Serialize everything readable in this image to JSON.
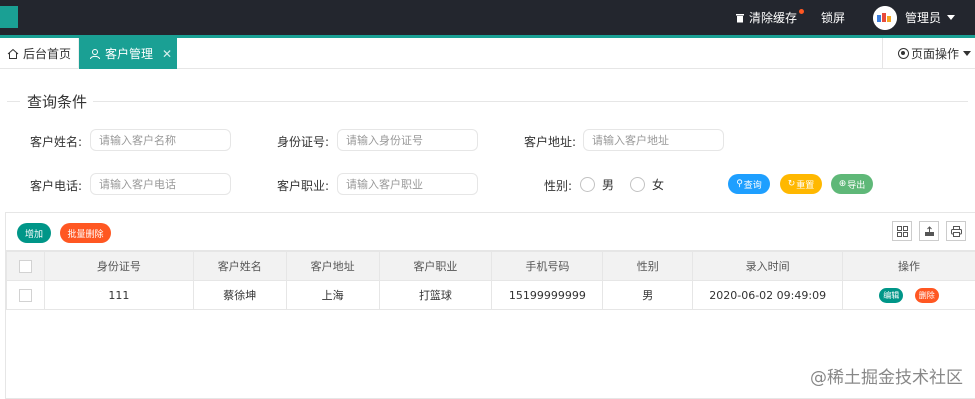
{
  "topbar": {
    "clear_cache": "清除缓存",
    "lock_screen": "锁屏",
    "admin": "管理员",
    "accent_color": "#1aa094",
    "dark_color": "#23262e"
  },
  "tabs": {
    "home": "后台首页",
    "active": "客户管理",
    "close": "✕",
    "page_ops": "页面操作"
  },
  "query": {
    "legend": "查询条件",
    "name_label": "客户姓名:",
    "name_placeholder": "请输入客户名称",
    "id_label": "身份证号:",
    "id_placeholder": "请输入身份证号",
    "address_label": "客户地址:",
    "address_placeholder": "请输入客户地址",
    "phone_label": "客户电话:",
    "phone_placeholder": "请输入客户电话",
    "job_label": "客户职业:",
    "job_placeholder": "请输入客户职业",
    "gender_label": "性别:",
    "gender_male": "男",
    "gender_female": "女",
    "search_btn": "查询",
    "reset_btn": "重置",
    "export_btn": "导出"
  },
  "toolbar": {
    "add_btn": "增加",
    "batch_delete_btn": "批量删除"
  },
  "table": {
    "headers": [
      "身份证号",
      "客户姓名",
      "客户地址",
      "客户职业",
      "手机号码",
      "性别",
      "录入时间",
      "操作"
    ],
    "rows": [
      {
        "id": "111",
        "name": "蔡徐坤",
        "address": "上海",
        "job": "打篮球",
        "phone": "15199999999",
        "gender": "男",
        "time": "2020-06-02 09:49:09",
        "edit": "编辑",
        "delete": "删除"
      }
    ]
  },
  "watermark": "@稀土掘金技术社区"
}
